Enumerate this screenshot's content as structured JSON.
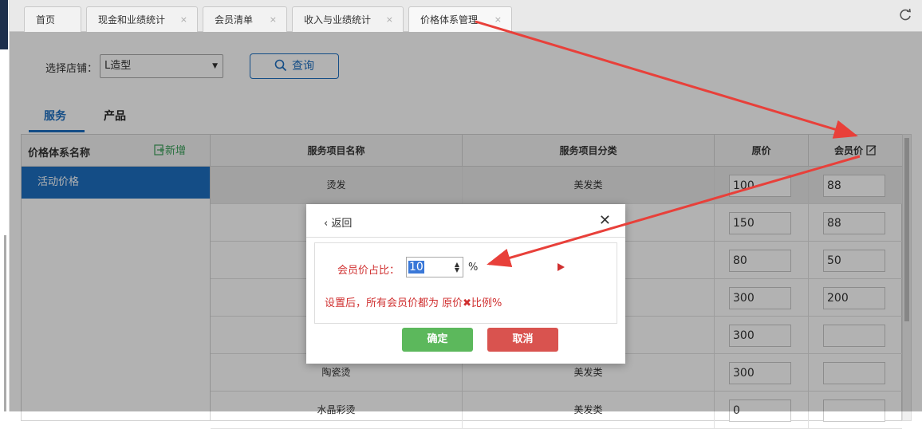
{
  "tabs": [
    {
      "label": "首页",
      "closable": false
    },
    {
      "label": "现金和业绩统计",
      "closable": true
    },
    {
      "label": "会员清单",
      "closable": true
    },
    {
      "label": "收入与业绩统计",
      "closable": true
    },
    {
      "label": "价格体系管理",
      "closable": true,
      "active": true
    }
  ],
  "tab_close_glyph": "×",
  "refresh_icon": "refresh-icon",
  "filter": {
    "store_label": "选择店铺：",
    "store_value": "L造型",
    "query_label": "查询"
  },
  "subtabs": {
    "services": "服务",
    "products": "产品",
    "active": "services"
  },
  "left_panel": {
    "title": "价格体系名称",
    "add_label": "新增",
    "items": [
      "活动价格"
    ]
  },
  "table": {
    "headers": {
      "name": "服务项目名称",
      "category": "服务项目分类",
      "original": "原价",
      "member": "会员价"
    },
    "rows": [
      {
        "name": "烫发",
        "category": "美发类",
        "original": "100",
        "member": "88"
      },
      {
        "name": "",
        "category": "",
        "original": "150",
        "member": "88"
      },
      {
        "name": "",
        "category": "",
        "original": "80",
        "member": "50"
      },
      {
        "name": "",
        "category": "",
        "original": "300",
        "member": "200"
      },
      {
        "name": "",
        "category": "",
        "original": "300",
        "member": ""
      },
      {
        "name": "陶瓷烫",
        "category": "美发类",
        "original": "300",
        "member": ""
      },
      {
        "name": "水晶彩烫",
        "category": "美发类",
        "original": "0",
        "member": ""
      }
    ]
  },
  "modal": {
    "back_label": "返回",
    "ratio_label": "会员价占比：",
    "ratio_value": "10",
    "percent_sign": "%",
    "hint": "设置后，所有会员价都为 原价✖比例%",
    "ok_label": "确定",
    "cancel_label": "取消"
  },
  "colors": {
    "accent": "#1e6fc0",
    "ok": "#5cb85c",
    "cancel": "#d9534f",
    "annotation": "#e8403a"
  }
}
